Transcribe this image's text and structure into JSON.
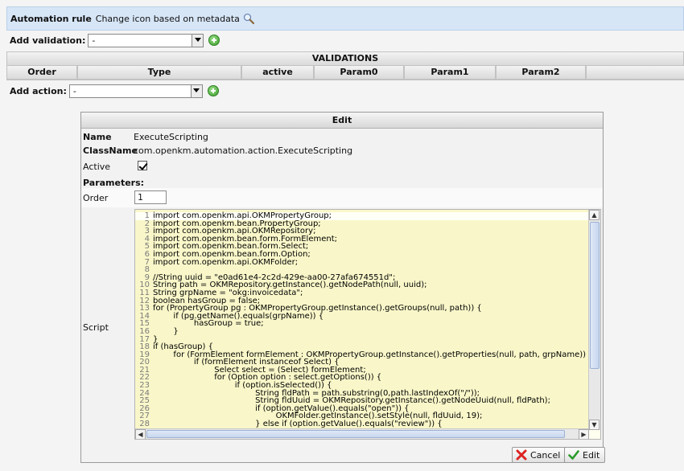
{
  "rule": {
    "label": "Automation rule",
    "name": "Change icon based on metadata",
    "icon": "magnifier-icon"
  },
  "add_validation": {
    "label": "Add validation:",
    "value": "-"
  },
  "validations": {
    "title": "VALIDATIONS",
    "columns": [
      "Order",
      "Type",
      "active",
      "Param0",
      "Param1",
      "Param2"
    ]
  },
  "add_action": {
    "label": "Add action:",
    "value": "-"
  },
  "edit": {
    "title": "Edit",
    "name_label": "Name",
    "name_value": "ExecuteScripting",
    "classname_label": "ClassName",
    "classname_value": "com.openkm.automation.action.ExecuteScripting",
    "active_label": "Active",
    "active_checked": true,
    "parameters_label": "Parameters:",
    "order_label": "Order",
    "order_value": "1",
    "script_label": "Script",
    "cancel_label": "Cancel",
    "edit_label": "Edit"
  },
  "script_lines": [
    {
      "n": "1",
      "t": "import com.openkm.api.OKMPropertyGroup;"
    },
    {
      "n": "2",
      "t": "import com.openkm.bean.PropertyGroup;"
    },
    {
      "n": "3",
      "t": "import com.openkm.api.OKMRepository;"
    },
    {
      "n": "4",
      "t": "import com.openkm.bean.form.FormElement;"
    },
    {
      "n": "5",
      "t": "import com.openkm.bean.form.Select;"
    },
    {
      "n": "6",
      "t": "import com.openkm.bean.form.Option;"
    },
    {
      "n": "7",
      "t": "import com.openkm.api.OKMFolder;"
    },
    {
      "n": "8",
      "t": ""
    },
    {
      "n": "9",
      "t": "//String uuid = \"e0ad61e4-2c2d-429e-aa00-27afa674551d\";"
    },
    {
      "n": "10",
      "t": "String path = OKMRepository.getInstance().getNodePath(null, uuid);"
    },
    {
      "n": "11",
      "t": "String grpName = \"okg:invoicedata\";"
    },
    {
      "n": "12",
      "t": "boolean hasGroup = false;"
    },
    {
      "n": "13",
      "t": "for (PropertyGroup pg : OKMPropertyGroup.getInstance().getGroups(null, path)) {"
    },
    {
      "n": "14",
      "t": "        if (pg.getName().equals(grpName)) {"
    },
    {
      "n": "15",
      "t": "                hasGroup = true;"
    },
    {
      "n": "16",
      "t": "        }"
    },
    {
      "n": "17",
      "t": "}"
    },
    {
      "n": "18",
      "t": "if (hasGroup) {"
    },
    {
      "n": "19",
      "t": "        for (FormElement formElement : OKMPropertyGroup.getInstance().getProperties(null, path, grpName))"
    },
    {
      "n": "20",
      "t": "                if (formElement instanceof Select) {"
    },
    {
      "n": "21",
      "t": "                        Select select = (Select) formElement;"
    },
    {
      "n": "22",
      "t": "                        for (Option option : select.getOptions()) {"
    },
    {
      "n": "23",
      "t": "                                if (option.isSelected()) {"
    },
    {
      "n": "24",
      "t": "                                        String fldPath = path.substring(0,path.lastIndexOf(\"/\"));"
    },
    {
      "n": "25",
      "t": "                                        String fldUuid = OKMRepository.getInstance().getNodeUuid(null, fldPath);"
    },
    {
      "n": "26",
      "t": "                                        if (option.getValue().equals(\"open\")) {"
    },
    {
      "n": "27",
      "t": "                                                OKMFolder.getInstance().setStyle(null, fldUuid, 19);"
    },
    {
      "n": "28",
      "t": "                                        } else if (option.getValue().equals(\"review\")) {"
    }
  ]
}
